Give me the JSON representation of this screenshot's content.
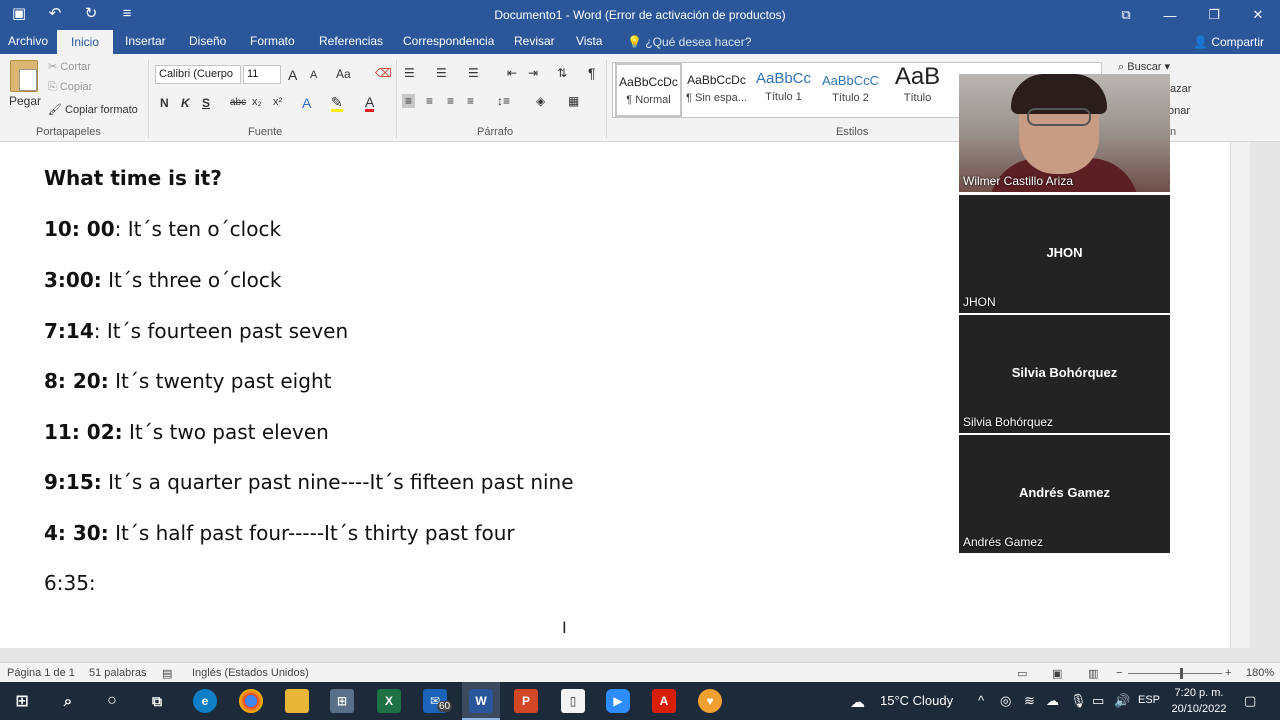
{
  "window": {
    "title": "Documento1 - Word (Error de activación de productos)",
    "controls": [
      "⧉",
      "—",
      "❐",
      "✕"
    ]
  },
  "quick_access": [
    "save-icon",
    "undo-icon",
    "redo-icon",
    "customize-icon"
  ],
  "tabs": [
    {
      "label": "Archivo"
    },
    {
      "label": "Inicio",
      "active": true
    },
    {
      "label": "Insertar"
    },
    {
      "label": "Diseño"
    },
    {
      "label": "Formato"
    },
    {
      "label": "Referencias"
    },
    {
      "label": "Correspondencia"
    },
    {
      "label": "Revisar"
    },
    {
      "label": "Vista"
    }
  ],
  "tell_me": "¿Qué desea hacer?",
  "share": "Compartir",
  "ribbon": {
    "clipboard": {
      "group": "Portapapeles",
      "paste": "Pegar",
      "cut": "Cortar",
      "copy": "Copiar",
      "format_painter": "Copiar formato"
    },
    "font": {
      "group": "Fuente",
      "font_name": "Calibri (Cuerpo",
      "font_size": "11",
      "bold": "N",
      "italic": "K",
      "underline": "S",
      "strike": "abc",
      "sub": "x₂",
      "sup": "x²",
      "case": "Aa",
      "grow": "A",
      "shrink": "A"
    },
    "paragraph": {
      "group": "Párrafo",
      "pilcrow": "¶"
    },
    "styles": {
      "group": "Estilos",
      "items": [
        {
          "sample": "AaBbCcDc",
          "name": "¶ Normal"
        },
        {
          "sample": "AaBbCcDc",
          "name": "¶ Sin espa..."
        },
        {
          "sample": "AaBbCc",
          "name": "Título 1"
        },
        {
          "sample": "AaBbCcC",
          "name": "Título 2"
        },
        {
          "sample": "AaB",
          "name": "Título"
        }
      ]
    },
    "editing": {
      "find": "Buscar",
      "replace_partial": "azar",
      "select_partial": "onar",
      "group_partial": "n"
    }
  },
  "document": {
    "heading": "What time is it?",
    "lines": [
      {
        "time": "10: 00",
        "sep": ": ",
        "text": "It´s ten o´clock"
      },
      {
        "time": "3:00:",
        "sep": " ",
        "text": "It´s three o´clock"
      },
      {
        "time": "7:14",
        "sep": ": ",
        "text": "It´s fourteen past seven"
      },
      {
        "time": "8: 20:",
        "sep": " ",
        "text": "It´s twenty past eight"
      },
      {
        "time": "11: 02:",
        "sep": " ",
        "text": "It´s two past eleven"
      },
      {
        "time": "9:15:",
        "sep": " ",
        "text": "It´s a quarter past nine----It´s fifteen past nine"
      },
      {
        "time": "4: 30:",
        "sep": " ",
        "text": "It´s half past four-----It´s thirty past four"
      }
    ],
    "last_line": "6:35:"
  },
  "participants": [
    {
      "name": "Wilmer Castillo Ariza",
      "video": true
    },
    {
      "name": "JHON",
      "label": "JHON"
    },
    {
      "name": "Silvia Bohórquez",
      "label": "Silvia Bohórquez"
    },
    {
      "name": "Andrés Gamez",
      "label": "Andrés Gamez"
    }
  ],
  "status": {
    "page": "Página 1 de 1",
    "words": "51 palabras",
    "language": "Inglés (Estados Unidos)",
    "zoom": "180%"
  },
  "taskbar": {
    "weather": "15°C  Cloudy",
    "lang": "ESP",
    "time": "7:20 p. m.",
    "date": "20/10/2022",
    "mail_badge": "60"
  }
}
